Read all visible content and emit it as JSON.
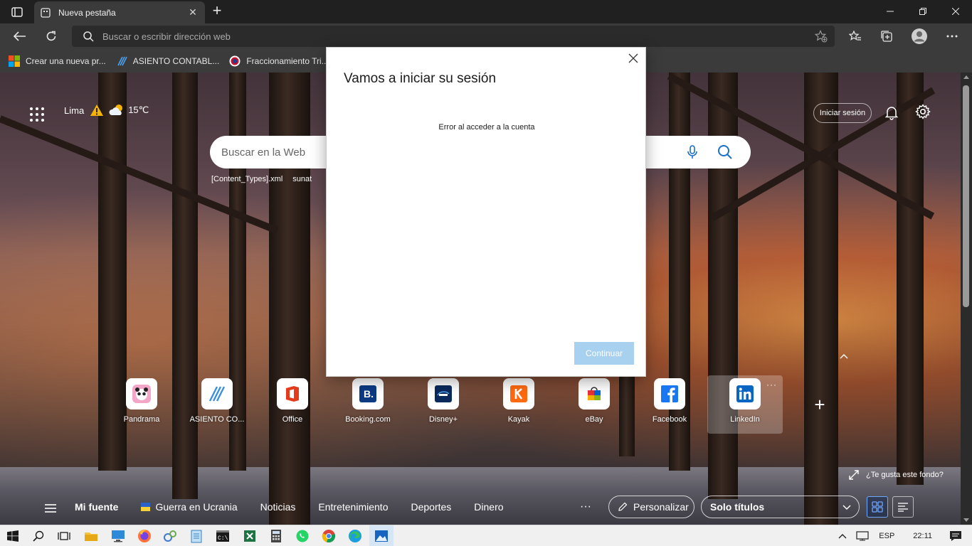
{
  "browser": {
    "tab_title": "Nueva pestaña",
    "address_placeholder": "Buscar o escribir dirección web",
    "bookmarks": [
      {
        "label": "Crear una nueva pr...",
        "icon": "microsoft-logo-icon"
      },
      {
        "label": "ASIENTO CONTABL...",
        "icon": "asiento-logo-icon"
      },
      {
        "label": "Fraccionamiento Tri...",
        "icon": "sunat-logo-icon"
      }
    ]
  },
  "newtab": {
    "weather": {
      "city": "Lima",
      "temperature": "15℃",
      "alert_icon": "warning-icon",
      "condition_icon": "partly-cloudy-icon"
    },
    "signin_label": "Iniciar sesión",
    "search_placeholder": "Buscar en la Web",
    "suggestions": [
      "[Content_Types].xml",
      "sunat"
    ],
    "tiles": [
      {
        "label": "Pandrama",
        "icon": "pandrama-icon"
      },
      {
        "label": "ASIENTO CO...",
        "icon": "asiento-icon"
      },
      {
        "label": "Office",
        "icon": "office-icon"
      },
      {
        "label": "Booking.com",
        "icon": "booking-icon"
      },
      {
        "label": "Disney+",
        "icon": "disney-plus-icon"
      },
      {
        "label": "Kayak",
        "icon": "kayak-icon"
      },
      {
        "label": "eBay",
        "icon": "ebay-icon"
      },
      {
        "label": "Facebook",
        "icon": "facebook-icon"
      },
      {
        "label": "LinkedIn",
        "icon": "linkedin-icon"
      }
    ],
    "background_feedback": "¿Te gusta este fondo?",
    "feed": {
      "tabs": [
        "Mi fuente",
        "Guerra en Ucrania",
        "Noticias",
        "Entretenimiento",
        "Deportes",
        "Dinero"
      ],
      "more": "···",
      "personalize_label": "Personalizar",
      "layout_value": "Solo títulos"
    }
  },
  "dialog": {
    "title": "Vamos a iniciar su sesión",
    "message": "Error al acceder a la cuenta",
    "continue_label": "Continuar"
  },
  "taskbar": {
    "language": "ESP",
    "time": "22:11"
  },
  "colors": {
    "browser_dark": "#202020",
    "toolbar": "#3b3b3b",
    "continue_disabled": "#a7d1ee",
    "taskbar": "#f0f0f0"
  }
}
